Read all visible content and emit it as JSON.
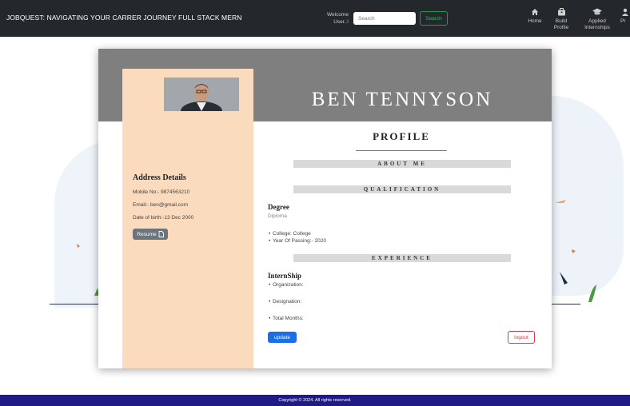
{
  "navbar": {
    "brand": "JOBQUEST: NAVIGATING YOUR CARRER JOURNEY FULL STACK MERN",
    "welcome": "Welcome User..!",
    "search_placeholder": "Search",
    "search_button": "Search",
    "items": [
      {
        "label": "Home",
        "icon": "home-icon"
      },
      {
        "label": "Build Profile",
        "icon": "briefcase-icon"
      },
      {
        "label": "Applied Internships",
        "icon": "graduation-cap-icon"
      },
      {
        "label": "Pr",
        "icon": "user-icon"
      }
    ]
  },
  "profile": {
    "name": "BEN TENNYSON",
    "section_title": "PROFILE",
    "address_title": "Address Details",
    "mobile": "Mobile No:- 9874563210",
    "email": "Email:- ben@gmail.com",
    "dob": "Date of birth:-13 Dec 2000",
    "resume_button": "Resume",
    "about_me_heading": "ABOUT ME",
    "qualification_heading": "QUALIFICATION",
    "degree_title": "Degree",
    "degree_value": "Diploma",
    "college": "College: College",
    "year_of_passing": "Year Of Passing:- 2020",
    "experience_heading": "EXPERIENCE",
    "internship_title": "InternShip",
    "organization": "Organization:",
    "designation": "Designation:",
    "total_months": "Total Months:",
    "update_button": "update",
    "logout_button": "logout"
  },
  "footer": {
    "text": "Copyright © 2024. All rights reserved."
  },
  "colors": {
    "navbar_bg": "#24282d",
    "header_gray": "#7f7f7f",
    "sidebar_peach": "#fadbbd",
    "footer_bg": "#1f1a84",
    "update_blue": "#1a6fe8",
    "logout_red": "#dc3545",
    "search_green": "#2fb463"
  }
}
